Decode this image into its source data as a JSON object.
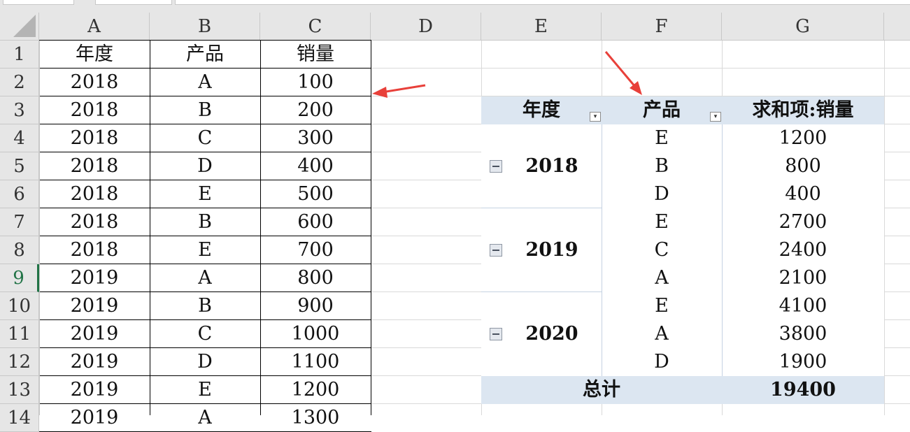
{
  "columns": [
    "A",
    "B",
    "C",
    "D",
    "E",
    "F",
    "G"
  ],
  "rows": [
    "1",
    "2",
    "3",
    "4",
    "5",
    "6",
    "7",
    "8",
    "9",
    "10",
    "11",
    "12",
    "13",
    "14"
  ],
  "selected_row": "9",
  "source_table": {
    "headers": [
      "年度",
      "产品",
      "销量"
    ],
    "records": [
      [
        "2018",
        "A",
        "100"
      ],
      [
        "2018",
        "B",
        "200"
      ],
      [
        "2018",
        "C",
        "300"
      ],
      [
        "2018",
        "D",
        "400"
      ],
      [
        "2018",
        "E",
        "500"
      ],
      [
        "2018",
        "B",
        "600"
      ],
      [
        "2018",
        "E",
        "700"
      ],
      [
        "2019",
        "A",
        "800"
      ],
      [
        "2019",
        "B",
        "900"
      ],
      [
        "2019",
        "C",
        "1000"
      ],
      [
        "2019",
        "D",
        "1100"
      ],
      [
        "2019",
        "E",
        "1200"
      ],
      [
        "2019",
        "A",
        "1300"
      ]
    ]
  },
  "pivot": {
    "header_year": "年度",
    "header_product": "产品",
    "header_sum": "求和项:销量",
    "groups": [
      {
        "year": "2018",
        "items": [
          {
            "product": "E",
            "value": "1200"
          },
          {
            "product": "B",
            "value": "800"
          },
          {
            "product": "D",
            "value": "400"
          }
        ]
      },
      {
        "year": "2019",
        "items": [
          {
            "product": "E",
            "value": "2700"
          },
          {
            "product": "C",
            "value": "2400"
          },
          {
            "product": "A",
            "value": "2100"
          }
        ]
      },
      {
        "year": "2020",
        "items": [
          {
            "product": "E",
            "value": "4100"
          },
          {
            "product": "A",
            "value": "3800"
          },
          {
            "product": "D",
            "value": "1900"
          }
        ]
      }
    ],
    "total_label": "总计",
    "total_value": "19400"
  },
  "colors": {
    "header_bg": "#e6e6e6",
    "pivot_header_bg": "#dce6f1",
    "selected_row": "#217346",
    "arrow": "#e8403a"
  }
}
